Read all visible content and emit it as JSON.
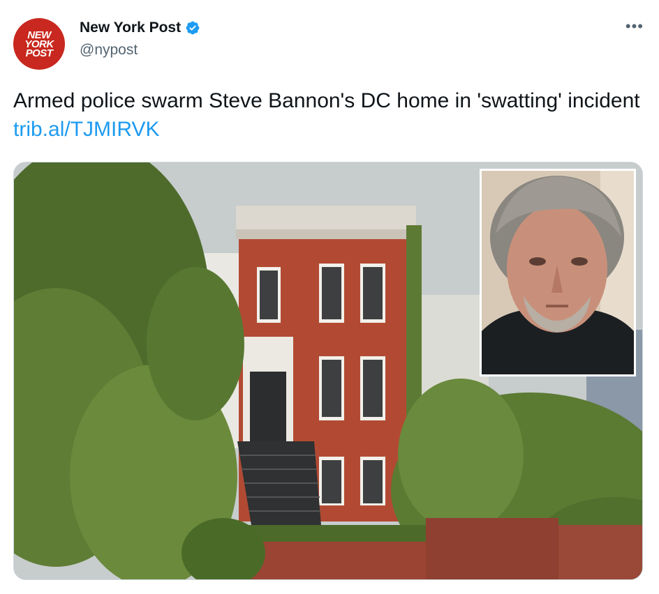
{
  "account": {
    "display_name": "New York Post",
    "handle": "@nypost",
    "avatar_logo": [
      "NEW",
      "YORK",
      "POST"
    ],
    "brand_color": "#c8281f",
    "verified": true
  },
  "tweet": {
    "text": "Armed police swarm Steve Bannon's DC home in 'swatting' incident ",
    "link": "trib.al/TJMIRVK",
    "link_color": "#1d9bf0"
  },
  "menu": {
    "more_label": "•••"
  },
  "icons": {
    "verified": "verified-badge-icon",
    "more": "more-options-icon"
  },
  "media": {
    "description_hidden": true
  }
}
